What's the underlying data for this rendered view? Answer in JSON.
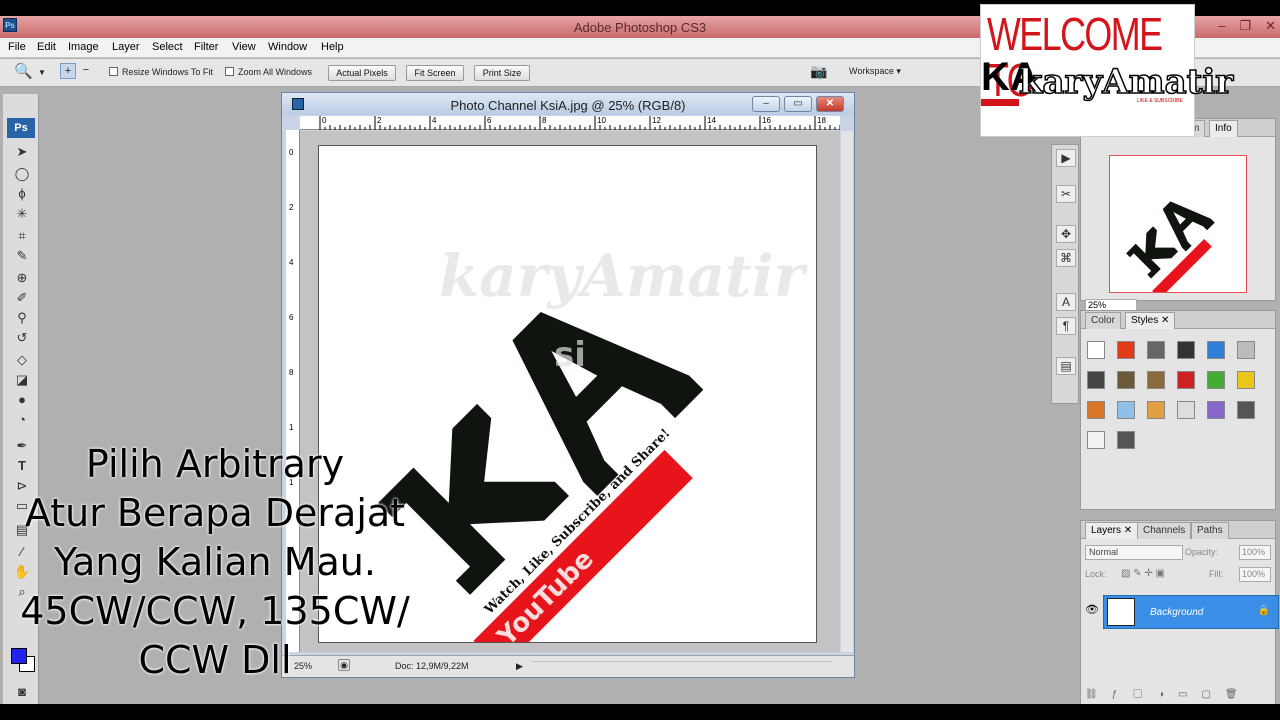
{
  "app": {
    "logo": "Ps",
    "title": "Adobe Photoshop CS3",
    "window_controls": [
      "–",
      "❐",
      "✕"
    ]
  },
  "menu": [
    "File",
    "Edit",
    "Image",
    "Layer",
    "Select",
    "Filter",
    "View",
    "Window",
    "Help"
  ],
  "options": {
    "resize_windows_to_fit": "Resize Windows To Fit",
    "zoom_all_windows": "Zoom All Windows",
    "actual_pixels": "Actual Pixels",
    "fit_screen": "Fit Screen",
    "print_size": "Print Size",
    "workspace": "Workspace ▾"
  },
  "toolbox": {
    "logo": "Ps",
    "icons": [
      "move-icon",
      "marquee-icon",
      "lasso-icon",
      "magic-wand-icon",
      "crop-icon",
      "slice-icon",
      "healing-icon",
      "brush-icon",
      "clone-stamp-icon",
      "history-brush-icon",
      "eraser-icon",
      "paint-bucket-icon",
      "blur-icon",
      "dodge-icon",
      "pen-icon",
      "type-icon",
      "path-select-icon",
      "shape-icon",
      "notes-icon",
      "eyedropper-icon",
      "hand-icon",
      "zoom-icon"
    ],
    "colors": {
      "foreground": "#2222ee",
      "background": "#ffffff"
    }
  },
  "document": {
    "title": "Photo Channel KsiA.jpg @ 25% (RGB/8)",
    "ruler_top": [
      "0",
      "2",
      "4",
      "6",
      "8",
      "10",
      "12",
      "14",
      "16",
      "18"
    ],
    "ruler_left": [
      "0",
      "2",
      "4",
      "6",
      "8",
      "1",
      "1"
    ],
    "zoom": "25%",
    "doc_size": "Doc: 12,9M/9,22M",
    "image": {
      "watermark_main": "karyAmatir",
      "watermark_small": "si",
      "banner_text": "Watch, Like, Subscribe, and Share!",
      "banner_brand": "YouTube",
      "colors": {
        "logo": "#0f140f",
        "banner": "#e8141b"
      }
    }
  },
  "panels": {
    "navigator": {
      "tabs": [
        "m",
        "Info"
      ],
      "zoom": "25%"
    },
    "color_styles": {
      "tabs": [
        "Color",
        "Styles ✕"
      ],
      "swatches": [
        "#ffffff",
        "#e33a1a",
        "#666666",
        "#333333",
        "#2f7fd8",
        "#bbbbbb",
        "#444444",
        "#6b5a3a",
        "#8a6a3a",
        "#cc2222",
        "#44aa33",
        "#e8c61a",
        "#d8762a",
        "#8fc0e8",
        "#e0a040",
        "#dddddd",
        "#8866cc",
        "#555555",
        "#f2f2f2",
        "#555555"
      ]
    },
    "layers": {
      "tabs": [
        "Layers ✕",
        "Channels",
        "Paths"
      ],
      "blend_mode": "Normal",
      "opacity_label": "Opacity:",
      "opacity": "100%",
      "lock_label": "Lock:",
      "fill_label": "Fill:",
      "fill": "100%",
      "layer_name": "Background"
    }
  },
  "overlay": {
    "lines": [
      "Pilih Arbitrary",
      "Atur Berapa Derajat",
      "Yang Kalian Mau.",
      "45CW/CCW, 135CW/",
      "CCW Dll"
    ]
  },
  "welcome_badge": {
    "line1": "WELCOME TO",
    "line2": "KA",
    "line3": "karyAmatir",
    "tagline": "LIKE & SUBSCRIBE"
  }
}
